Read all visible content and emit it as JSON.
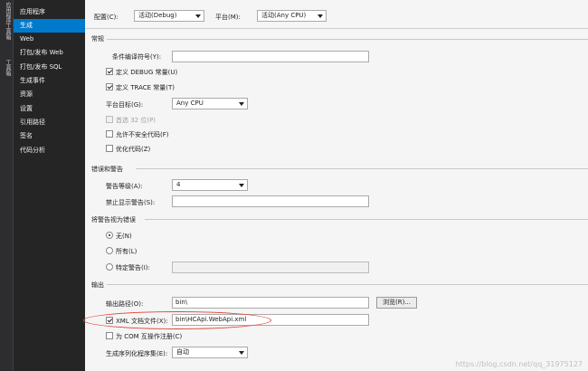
{
  "rail": {
    "tabs": [
      "应用程序工具箱",
      "工具箱"
    ]
  },
  "nav": {
    "items": [
      {
        "label": "应用程序"
      },
      {
        "label": "生成"
      },
      {
        "label": "Web"
      },
      {
        "label": "打包/发布 Web"
      },
      {
        "label": "打包/发布 SQL"
      },
      {
        "label": "生成事件"
      },
      {
        "label": "资源"
      },
      {
        "label": "设置"
      },
      {
        "label": "引用路径"
      },
      {
        "label": "签名"
      },
      {
        "label": "代码分析"
      }
    ],
    "active_index": 1
  },
  "toolbar": {
    "config_label": "配置(C):",
    "config_value": "活动(Debug)",
    "platform_label": "平台(M):",
    "platform_value": "活动(Any CPU)"
  },
  "general": {
    "title": "常规",
    "conditional_symbols_label": "条件编译符号(Y):",
    "conditional_symbols_value": "",
    "define_debug_label": "定义 DEBUG 常量(U)",
    "define_debug_checked": true,
    "define_trace_label": "定义 TRACE 常量(T)",
    "define_trace_checked": true,
    "platform_target_label": "平台目标(G):",
    "platform_target_value": "Any CPU",
    "prefer32_label": "首选 32 位(P)",
    "unsafe_label": "允许不安全代码(F)",
    "optimize_label": "优化代码(Z)"
  },
  "errors": {
    "title": "错误和警告",
    "warning_level_label": "警告等级(A):",
    "warning_level_value": "4",
    "suppress_label": "禁止显示警告(S):",
    "suppress_value": ""
  },
  "treat_warnings": {
    "title": "将警告视为错误",
    "none_label": "无(N)",
    "all_label": "所有(L)",
    "specific_label": "特定警告(I):",
    "selected": "none"
  },
  "output": {
    "title": "输出",
    "path_label": "输出路径(O):",
    "path_value": "bin\\",
    "browse_label": "浏览(R)...",
    "xml_doc_label": "XML 文档文件(X):",
    "xml_doc_checked": true,
    "xml_doc_value": "bin\\HCApi.WebApi.xml",
    "com_interop_label": "为 COM 互操作注册(C)",
    "serialization_label": "生成序列化程序集(E):",
    "serialization_value": "自动"
  },
  "watermark": "https://blog.csdn.net/qq_31975127",
  "colors": {
    "accent": "#007acc",
    "highlight_ellipse": "#e0443a"
  }
}
